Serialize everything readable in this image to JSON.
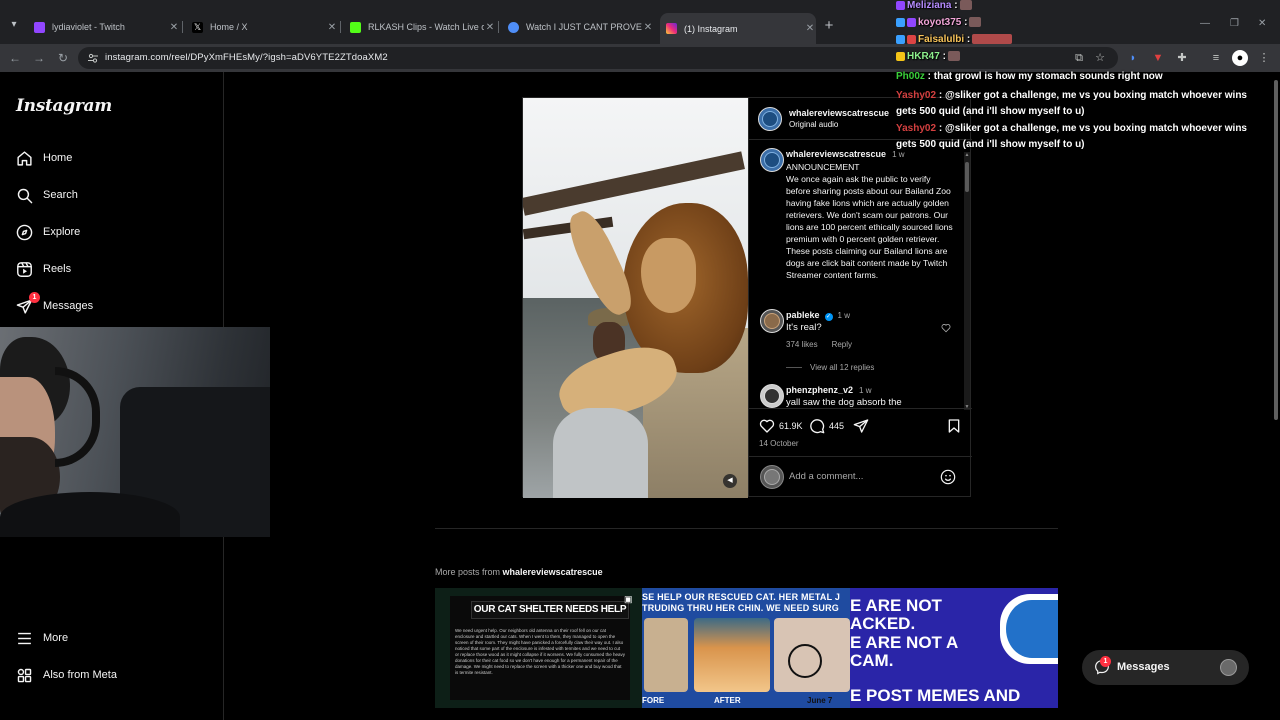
{
  "browser": {
    "tabs": [
      {
        "title": "lydiaviolet - Twitch",
        "color": "#9146ff"
      },
      {
        "title": "Home / X",
        "color": "#e8eaed"
      },
      {
        "title": "RLKASH Clips - Watch Live on K",
        "color": "#53fc18"
      },
      {
        "title": "Watch I JUST CANT PROVE IT |",
        "color": "#4f8ef7"
      },
      {
        "title": "(1) Instagram",
        "color": "#e1306c"
      }
    ],
    "url": "instagram.com/reel/DPyXmFHEsMy/?igsh=aDV6YTE2ZTdoaXM2"
  },
  "sidebar": {
    "logo": "Instagram",
    "items": [
      {
        "label": "Home"
      },
      {
        "label": "Search"
      },
      {
        "label": "Explore"
      },
      {
        "label": "Reels"
      },
      {
        "label": "Messages",
        "badge": "1"
      },
      {
        "label": "More"
      },
      {
        "label": "Also from Meta"
      }
    ]
  },
  "post": {
    "author": "whalereviewscatrescue",
    "audio": "Original audio",
    "caption": {
      "author": "whalereviewscatrescue",
      "time": "1 w",
      "text": "ANNOUNCEMENT\nWe once again ask the public to verify before sharing posts about our Bailand Zoo having fake lions which are actually golden retrievers. We don't scam our patrons. Our lions are 100 percent ethically sourced lions premium with 0 percent golden retriever. These posts claiming our Bailand lions are dogs are click bait content made by Twitch Streamer content farms."
    },
    "comments": [
      {
        "user": "pableke",
        "time": "1 w",
        "text": "It's real?",
        "likes": "374 likes",
        "reply": "Reply",
        "view_replies": "View all 12 replies"
      },
      {
        "user": "phenzphenz_v2",
        "time": "1 w",
        "text": "yall saw the dog absorb the"
      }
    ],
    "likes": "61.9K",
    "comment_count": "445",
    "date": "14 October",
    "comment_placeholder": "Add a comment..."
  },
  "more": {
    "label_prefix": "More posts from",
    "label_user": "whalereviewscatrescue",
    "post1": {
      "heading": "OUR CAT SHELTER NEEDS HELP",
      "body": "We need urgent help. Our neighbors old antenna on their roof fell on our cat enclosure and startled our cats. When I went to them, they managed to open the screen of their room. They might have panicked a forcefully claw their way out. I also noticed that some part of the enclosure is infested with termites and we need to cut or replace those wood as it might collapse if it worsens. We fully consumed the heavy donations for their cat food so we don't have enough for a permanent repair of the damage. We might need to replace the screen with a thicker one and buy wood that is termite resistant."
    },
    "post2": {
      "banner": "SE HELP OUR RESCUED CAT. HER METAL J",
      "banner2": "TRUDING THRU HER CHIN. WE NEED SURG",
      "before": "FORE",
      "after": "AFTER",
      "date": "June 7"
    },
    "post3": {
      "line1": "E ARE NOT",
      "line2": "ACKED.",
      "line3": "E ARE NOT A",
      "line4": "CAM.",
      "line5": "E POST MEMES AND"
    }
  },
  "messages_pill": {
    "label": "Messages",
    "badge": "1"
  },
  "chat": {
    "lines": [
      {
        "user": "Meliziana",
        "color": "#b58cff",
        "text": ""
      },
      {
        "user": "koyot375",
        "color": "#f2a5d8",
        "text": ""
      },
      {
        "user": "Faisalulbi",
        "color": "#f7c35a",
        "text": ""
      },
      {
        "user": "HKR47",
        "color": "#8ef08e",
        "text": ""
      },
      {
        "user": "Ph00z",
        "color": "#3ad13a",
        "text": "that growl is how my stomach sounds right now"
      },
      {
        "user": "Yashy02",
        "color": "#d44040",
        "text": "@sliker got a challenge, me vs you boxing match whoever wins gets 500 quid (and i'll show myself to u)"
      },
      {
        "user": "Yashy02",
        "color": "#d44040",
        "text": "@sliker got a challenge, me vs you boxing match whoever wins gets 500 quid (and i'll show myself to u)"
      }
    ]
  }
}
